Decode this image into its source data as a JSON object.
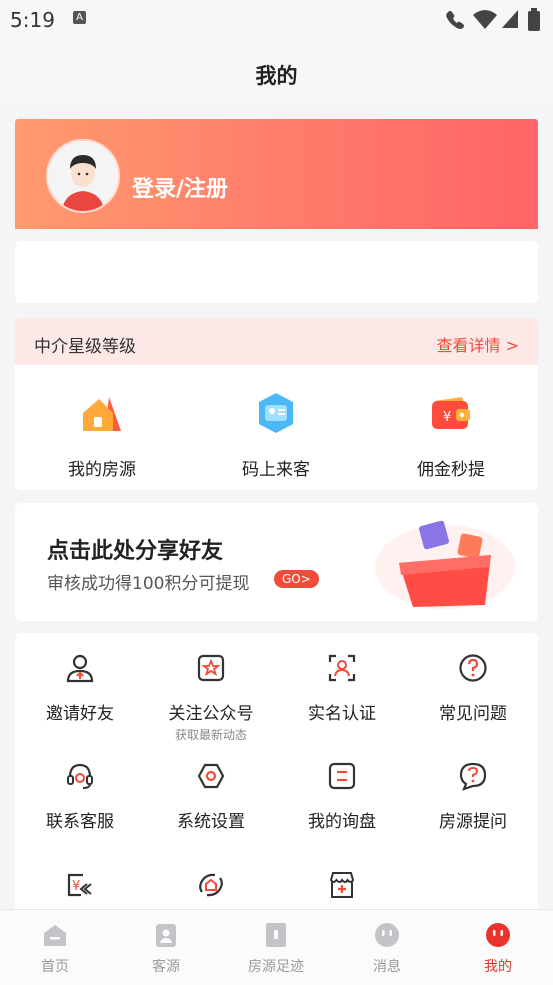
{
  "status_bar": {
    "time": "5:19",
    "a_icon": "A"
  },
  "header": {
    "title": "我的"
  },
  "login": {
    "label": "登录/注册"
  },
  "level": {
    "label": "中介星级等级",
    "detail_link": "查看详情 >"
  },
  "shortcuts": [
    {
      "label": "我的房源",
      "icon": "house-icon"
    },
    {
      "label": "码上来客",
      "icon": "customer-card-icon"
    },
    {
      "label": "佣金秒提",
      "icon": "wallet-icon"
    }
  ],
  "banner": {
    "title": "点击此处分享好友",
    "subtitle": "审核成功得100积分可提现",
    "go_label": "GO>"
  },
  "services": [
    {
      "label": "邀请好友",
      "icon": "invite-user-icon"
    },
    {
      "label": "关注公众号",
      "sublabel": "获取最新动态",
      "icon": "follow-star-icon"
    },
    {
      "label": "实名认证",
      "icon": "id-verify-icon"
    },
    {
      "label": "常见问题",
      "icon": "question-icon"
    },
    {
      "label": "联系客服",
      "icon": "headset-icon"
    },
    {
      "label": "系统设置",
      "icon": "settings-icon"
    },
    {
      "label": "我的询盘",
      "icon": "inquiry-icon"
    },
    {
      "label": "房源提问",
      "icon": "question-bubble-icon"
    },
    {
      "label": "",
      "icon": "yuan-back-icon"
    },
    {
      "label": "",
      "icon": "house-orbit-icon"
    },
    {
      "label": "",
      "icon": "shop-plus-icon"
    }
  ],
  "tabs": [
    {
      "label": "首页",
      "icon": "home-icon",
      "active": false
    },
    {
      "label": "客源",
      "icon": "customer-icon",
      "active": false
    },
    {
      "label": "房源足迹",
      "icon": "footprint-icon",
      "active": false
    },
    {
      "label": "消息",
      "icon": "message-icon",
      "active": false
    },
    {
      "label": "我的",
      "icon": "me-icon",
      "active": true
    }
  ],
  "colors": {
    "accent": "#f04b3b",
    "active_tab": "#e8342c",
    "card_gradient_start": "#ff9a6e",
    "card_gradient_end": "#ff6567"
  }
}
